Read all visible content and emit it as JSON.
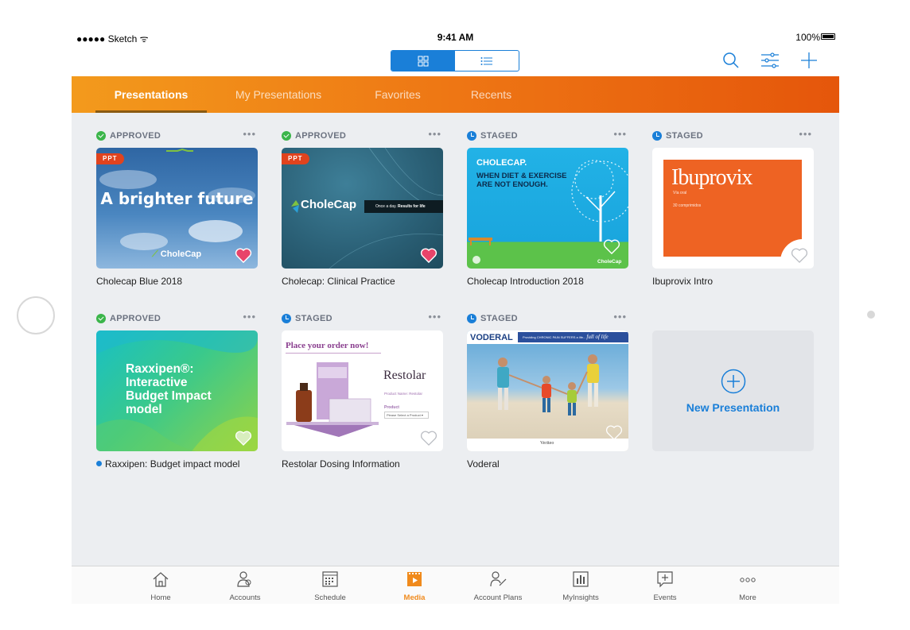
{
  "status_bar": {
    "carrier": "●●●●● Sketch ᯤ",
    "time": "9:41 AM",
    "battery": "100%"
  },
  "top_tabs": [
    {
      "label": "Presentations",
      "active": true
    },
    {
      "label": "My Presentations",
      "active": false
    },
    {
      "label": "Favorites",
      "active": false
    },
    {
      "label": "Recents",
      "active": false
    }
  ],
  "cards": [
    {
      "status": "APPROVED",
      "title": "Cholecap Blue 2018",
      "badge": "PPT",
      "favorite": true,
      "thumb": {
        "headline": "A brighter future",
        "logo": "CholeCap"
      }
    },
    {
      "status": "APPROVED",
      "title": "Cholecap: Clinical Practice",
      "badge": "PPT",
      "favorite": true,
      "thumb": {
        "logo": "CholeCap",
        "tagline_a": "Once a day.",
        "tagline_b": "Results for life"
      }
    },
    {
      "status": "STAGED",
      "title": "Cholecap Introduction 2018",
      "favorite": false,
      "thumb": {
        "line1": "CHOLECAP.",
        "line2": "WHEN DIET & EXERCISE",
        "line3": "ARE NOT ENOUGH.",
        "logo": "CholeCap"
      }
    },
    {
      "status": "STAGED",
      "title": "Ibuprovix Intro",
      "favorite": false,
      "thumb": {
        "brand": "Ibuprovix",
        "sub1": "Vía oral",
        "sub2": "30 comprimidos"
      }
    },
    {
      "status": "APPROVED",
      "title": "Raxxipen: Budget impact model",
      "favorite": false,
      "unread": true,
      "thumb": {
        "line1": "Raxxipen®:",
        "line2": "Interactive",
        "line3": "Budget Impact",
        "line4": "model"
      }
    },
    {
      "status": "STAGED",
      "title": "Restolar Dosing Information",
      "favorite": false,
      "thumb": {
        "header": "Place your order now!",
        "brand": "Restolar",
        "product_name": "Product Name: Restolar",
        "product_label": "Product",
        "select": "Please Select a Product"
      }
    },
    {
      "status": "STAGED",
      "title": "Voderal",
      "favorite": false,
      "thumb": {
        "brand": "VODERAL",
        "tagline": "Providing CHRONIC PAIN SUFFERS a life...",
        "tagline_script": "full of life",
        "footer": "Veriteo"
      }
    }
  ],
  "new_presentation": {
    "label": "New Presentation"
  },
  "bottom_tabs": [
    {
      "label": "Home",
      "icon": "home-icon",
      "active": false
    },
    {
      "label": "Accounts",
      "icon": "accounts-icon",
      "active": false
    },
    {
      "label": "Schedule",
      "icon": "calendar-icon",
      "active": false
    },
    {
      "label": "Media",
      "icon": "media-icon",
      "active": true
    },
    {
      "label": "Account Plans",
      "icon": "account-plans-icon",
      "active": false
    },
    {
      "label": "MyInsights",
      "icon": "insights-icon",
      "active": false
    },
    {
      "label": "Events",
      "icon": "events-icon",
      "active": false
    },
    {
      "label": "More",
      "icon": "more-icon",
      "active": false
    }
  ],
  "colors": {
    "accent_blue": "#1a7fd8",
    "orange": "#ee7614",
    "approved_green": "#3bb54a",
    "heart_pink": "#e8446a"
  }
}
